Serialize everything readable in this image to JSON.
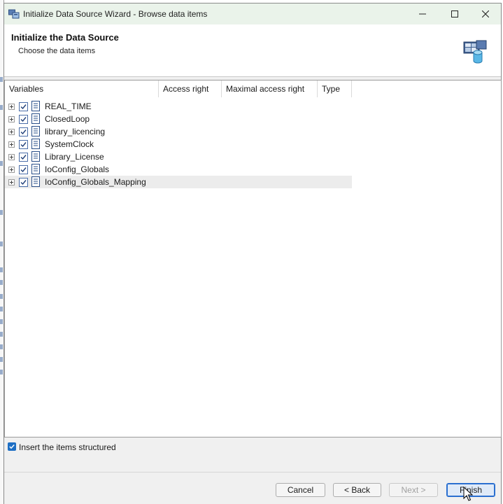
{
  "window": {
    "title": "Initialize Data Source Wizard - Browse data items",
    "controls": [
      "minimize-icon",
      "maximize-icon",
      "close-icon"
    ]
  },
  "header": {
    "title": "Initialize the Data Source",
    "subtitle": "Choose the data items",
    "icon": "data-source-icon"
  },
  "tree": {
    "columns": [
      "Variables",
      "Access right",
      "Maximal access right",
      "Type"
    ],
    "items": [
      {
        "label": "REAL_TIME",
        "checked": true,
        "selected": false
      },
      {
        "label": "ClosedLoop",
        "checked": true,
        "selected": false
      },
      {
        "label": "library_licencing",
        "checked": true,
        "selected": false
      },
      {
        "label": "SystemClock",
        "checked": true,
        "selected": false
      },
      {
        "label": "Library_License",
        "checked": true,
        "selected": false
      },
      {
        "label": "IoConfig_Globals",
        "checked": true,
        "selected": false
      },
      {
        "label": "IoConfig_Globals_Mapping",
        "checked": true,
        "selected": true
      }
    ]
  },
  "options": {
    "insert_structured_label": "Insert the items structured",
    "insert_structured_checked": true
  },
  "buttons": {
    "cancel": "Cancel",
    "back": "< Back",
    "next": "Next >",
    "finish": "Finish"
  },
  "colors": {
    "titlebar": "#eaf3ea",
    "accent": "#1e6fc4",
    "selected_row": "#ececec"
  }
}
